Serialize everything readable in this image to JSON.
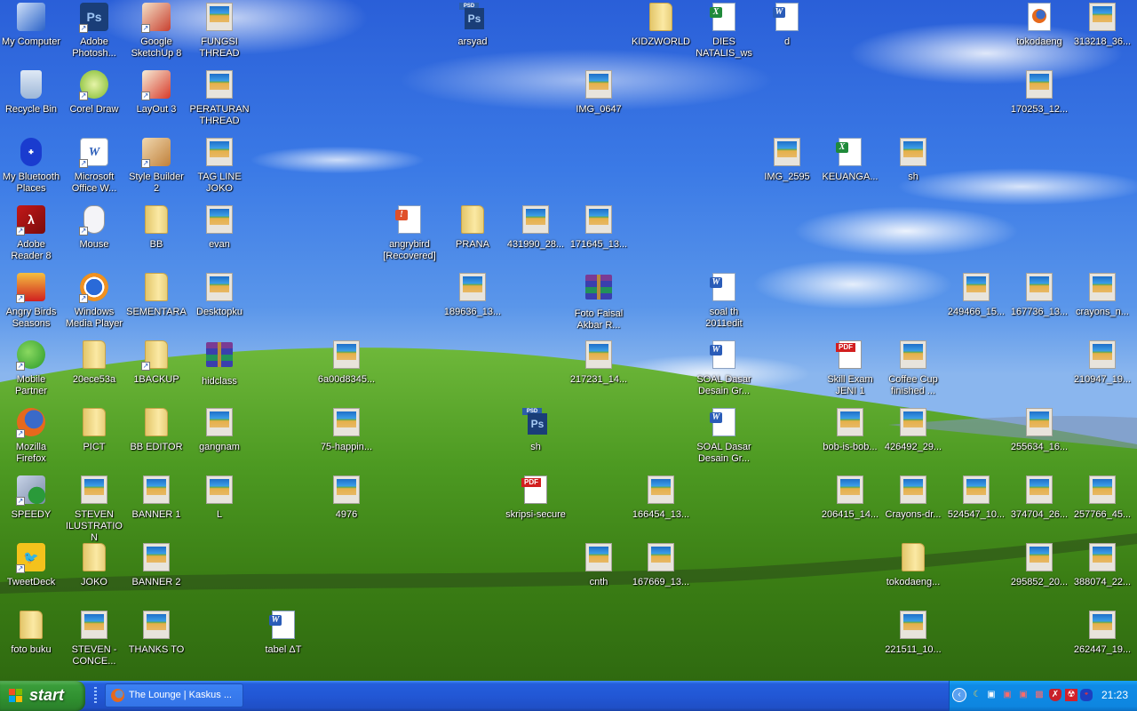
{
  "desktop": {
    "icons": [
      {
        "label": "My Computer",
        "type": "computer",
        "shortcut": false
      },
      {
        "label": "Adobe\nPhotosh...",
        "type": "photoshop",
        "shortcut": true
      },
      {
        "label": "Google\nSketchUp 8",
        "type": "sketchup",
        "shortcut": true
      },
      {
        "label": "FUNGSI\nTHREAD",
        "type": "image",
        "shortcut": false
      },
      {
        "label": "arsyad",
        "type": "psd",
        "shortcut": false
      },
      {
        "label": "KIDZWORLD",
        "type": "folder",
        "shortcut": false
      },
      {
        "label": "DIES\nNATALIS_ws",
        "type": "excel",
        "shortcut": false
      },
      {
        "label": "d",
        "type": "word",
        "shortcut": false
      },
      {
        "label": "tokodaeng",
        "type": "firefox-doc",
        "shortcut": false
      },
      {
        "label": "313218_36...",
        "type": "image",
        "shortcut": false
      },
      {
        "label": "Recycle Bin",
        "type": "recycle-bin",
        "shortcut": false
      },
      {
        "label": "Corel Draw",
        "type": "corel",
        "shortcut": true
      },
      {
        "label": "LayOut 3",
        "type": "layout",
        "shortcut": true
      },
      {
        "label": "PERATURAN\nTHREAD",
        "type": "image",
        "shortcut": false
      },
      {
        "label": "IMG_0647",
        "type": "image",
        "shortcut": false
      },
      {
        "label": "170253_12...",
        "type": "image",
        "shortcut": false
      },
      {
        "label": "My Bluetooth\nPlaces",
        "type": "bluetooth",
        "shortcut": false
      },
      {
        "label": "Microsoft\nOffice W...",
        "type": "word-app",
        "shortcut": true
      },
      {
        "label": "Style Builder\n2",
        "type": "style-builder",
        "shortcut": true
      },
      {
        "label": "TAG LINE\nJOKO",
        "type": "image",
        "shortcut": false
      },
      {
        "label": "IMG_2595",
        "type": "image",
        "shortcut": false
      },
      {
        "label": "KEUANGA...",
        "type": "excel",
        "shortcut": false
      },
      {
        "label": "sh",
        "type": "image",
        "shortcut": false
      },
      {
        "label": "Adobe\nReader 8",
        "type": "acrobat",
        "shortcut": true
      },
      {
        "label": "Mouse",
        "type": "mouse",
        "shortcut": true
      },
      {
        "label": "BB",
        "type": "folder",
        "shortcut": false
      },
      {
        "label": "evan",
        "type": "image",
        "shortcut": false
      },
      {
        "label": "angrybird\n[Recovered]",
        "type": "recovered-doc",
        "shortcut": false
      },
      {
        "label": "PRANA",
        "type": "folder",
        "shortcut": false
      },
      {
        "label": "431990_28...",
        "type": "image",
        "shortcut": false
      },
      {
        "label": "171645_13...",
        "type": "image",
        "shortcut": false
      },
      {
        "label": "Angry Birds\nSeasons",
        "type": "angry-birds",
        "shortcut": true
      },
      {
        "label": "Windows\nMedia Player",
        "type": "media-player",
        "shortcut": true
      },
      {
        "label": "SEMENTARA",
        "type": "folder",
        "shortcut": false
      },
      {
        "label": "Desktopku",
        "type": "image",
        "shortcut": false
      },
      {
        "label": "189636_13...",
        "type": "image",
        "shortcut": false
      },
      {
        "label": "Foto Faisal\nAkbar R...",
        "type": "rar",
        "shortcut": false
      },
      {
        "label": "soal th\n2011edit",
        "type": "word",
        "shortcut": false
      },
      {
        "label": "249466_15...",
        "type": "image",
        "shortcut": false
      },
      {
        "label": "167736_13...",
        "type": "image",
        "shortcut": false
      },
      {
        "label": "crayons_n...",
        "type": "image",
        "shortcut": false
      },
      {
        "label": "Mobile\nPartner",
        "type": "mobile-partner",
        "shortcut": true
      },
      {
        "label": "20ece53a",
        "type": "folder",
        "shortcut": false
      },
      {
        "label": "1BACKUP",
        "type": "folder",
        "shortcut": true
      },
      {
        "label": "hidclass",
        "type": "rar",
        "shortcut": false
      },
      {
        "label": "6a00d8345...",
        "type": "image",
        "shortcut": false
      },
      {
        "label": "217231_14...",
        "type": "image",
        "shortcut": false
      },
      {
        "label": "SOAL Dasar\nDesain Gr...",
        "type": "word",
        "shortcut": false
      },
      {
        "label": "Skill Exam\nJENI 1",
        "type": "pdf",
        "shortcut": false
      },
      {
        "label": "Coffee Cup\nfinished ...",
        "type": "image",
        "shortcut": false
      },
      {
        "label": "210947_19...",
        "type": "image",
        "shortcut": false
      },
      {
        "label": "Mozilla\nFirefox",
        "type": "firefox",
        "shortcut": true
      },
      {
        "label": "PICT",
        "type": "folder",
        "shortcut": false
      },
      {
        "label": "BB EDITOR",
        "type": "folder",
        "shortcut": false
      },
      {
        "label": "gangnam",
        "type": "image",
        "shortcut": false
      },
      {
        "label": "75-happin...",
        "type": "image",
        "shortcut": false
      },
      {
        "label": "sh",
        "type": "psd",
        "shortcut": false
      },
      {
        "label": "SOAL Dasar\nDesain Gr...",
        "type": "word",
        "shortcut": false
      },
      {
        "label": "bob-is-bob...",
        "type": "image",
        "shortcut": false
      },
      {
        "label": "426492_29...",
        "type": "image",
        "shortcut": false
      },
      {
        "label": "255634_16...",
        "type": "image",
        "shortcut": false
      },
      {
        "label": "SPEEDY",
        "type": "network",
        "shortcut": true
      },
      {
        "label": "STEVEN\nILUSTRATION",
        "type": "image",
        "shortcut": false
      },
      {
        "label": "BANNER 1",
        "type": "image",
        "shortcut": false
      },
      {
        "label": "L",
        "type": "image",
        "shortcut": false
      },
      {
        "label": "4976",
        "type": "image",
        "shortcut": false
      },
      {
        "label": "skripsi-secure",
        "type": "pdf",
        "shortcut": false
      },
      {
        "label": "166454_13...",
        "type": "image",
        "shortcut": false
      },
      {
        "label": "206415_14...",
        "type": "image",
        "shortcut": false
      },
      {
        "label": "Crayons-dr...",
        "type": "image",
        "shortcut": false
      },
      {
        "label": "524547_10...",
        "type": "image",
        "shortcut": false
      },
      {
        "label": "374704_26...",
        "type": "image",
        "shortcut": false
      },
      {
        "label": "257766_45...",
        "type": "image",
        "shortcut": false
      },
      {
        "label": "TweetDeck",
        "type": "tweetdeck",
        "shortcut": true
      },
      {
        "label": "JOKO",
        "type": "folder",
        "shortcut": false
      },
      {
        "label": "BANNER 2",
        "type": "image",
        "shortcut": false
      },
      {
        "label": "cnth",
        "type": "image",
        "shortcut": false
      },
      {
        "label": "167669_13...",
        "type": "image",
        "shortcut": false
      },
      {
        "label": "tokodaeng...",
        "type": "folder",
        "shortcut": false
      },
      {
        "label": "295852_20...",
        "type": "image",
        "shortcut": false
      },
      {
        "label": "388074_22...",
        "type": "image",
        "shortcut": false
      },
      {
        "label": "foto buku",
        "type": "folder",
        "shortcut": false
      },
      {
        "label": "STEVEN -\nCONCE...",
        "type": "image",
        "shortcut": false
      },
      {
        "label": "THANKS TO",
        "type": "image",
        "shortcut": false
      },
      {
        "label": "tabel ΔT",
        "type": "word",
        "shortcut": false
      },
      {
        "label": "221511_10...",
        "type": "image",
        "shortcut": false
      },
      {
        "label": "262447_19...",
        "type": "image",
        "shortcut": false
      }
    ]
  },
  "taskbar": {
    "start_label": "start",
    "tasks": [
      {
        "label": "The Lounge | Kaskus ...",
        "icon": "firefox-icon"
      }
    ],
    "tray": {
      "icons": [
        "show-hidden-icons",
        "sync-icon",
        "network-connected-icon",
        "network-disconnected-icon",
        "network-disconnected-icon",
        "wireless-disconnected-icon",
        "security-shield-icon",
        "antivirus-icon",
        "bluetooth-icon"
      ],
      "clock": "21:23"
    }
  },
  "colors": {
    "taskbar_blue": "#245edb",
    "start_green": "#3a9d3a",
    "tray_blue": "#0f8be6",
    "label_text": "#ffffff"
  }
}
